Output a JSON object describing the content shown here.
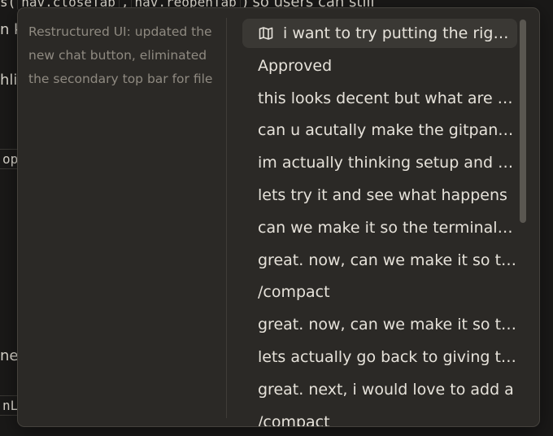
{
  "background": {
    "line1_prefix": "s(",
    "line1_code1": "nav.closeTab",
    "line1_mid": ",",
    "line1_code2": "nav.reopenTab",
    "line1_suffix": ") so users can still",
    "line2": "n k",
    "line3": "hli",
    "chip1": "opE",
    "line4": "nea",
    "chip2": "nLi"
  },
  "summary": {
    "text": "Restructured UI: updated the new chat button, eliminated the secondary top bar for file"
  },
  "list": {
    "items": [
      {
        "label": "i want to try putting the right sidebar in the primary area",
        "icon": "map-icon",
        "selected": true
      },
      {
        "label": "Approved"
      },
      {
        "label": "this looks decent but what are the options"
      },
      {
        "label": "can u acutally make the gitpanel wider"
      },
      {
        "label": "im actually thinking setup and config"
      },
      {
        "label": "lets try it and see what happens"
      },
      {
        "label": "can we make it so the terminal opens"
      },
      {
        "label": "great. now, can we make it so the tabs"
      },
      {
        "label": "/compact"
      },
      {
        "label": "great. now, can we make it so the"
      },
      {
        "label": "lets actually go back to giving the"
      },
      {
        "label": "great. next, i would love to add a"
      },
      {
        "label": "/compact"
      }
    ]
  },
  "colors": {
    "popover_bg": "#2b2926",
    "selected_bg": "#3a3834",
    "text": "#e6e2da",
    "muted": "#8f8a81"
  }
}
